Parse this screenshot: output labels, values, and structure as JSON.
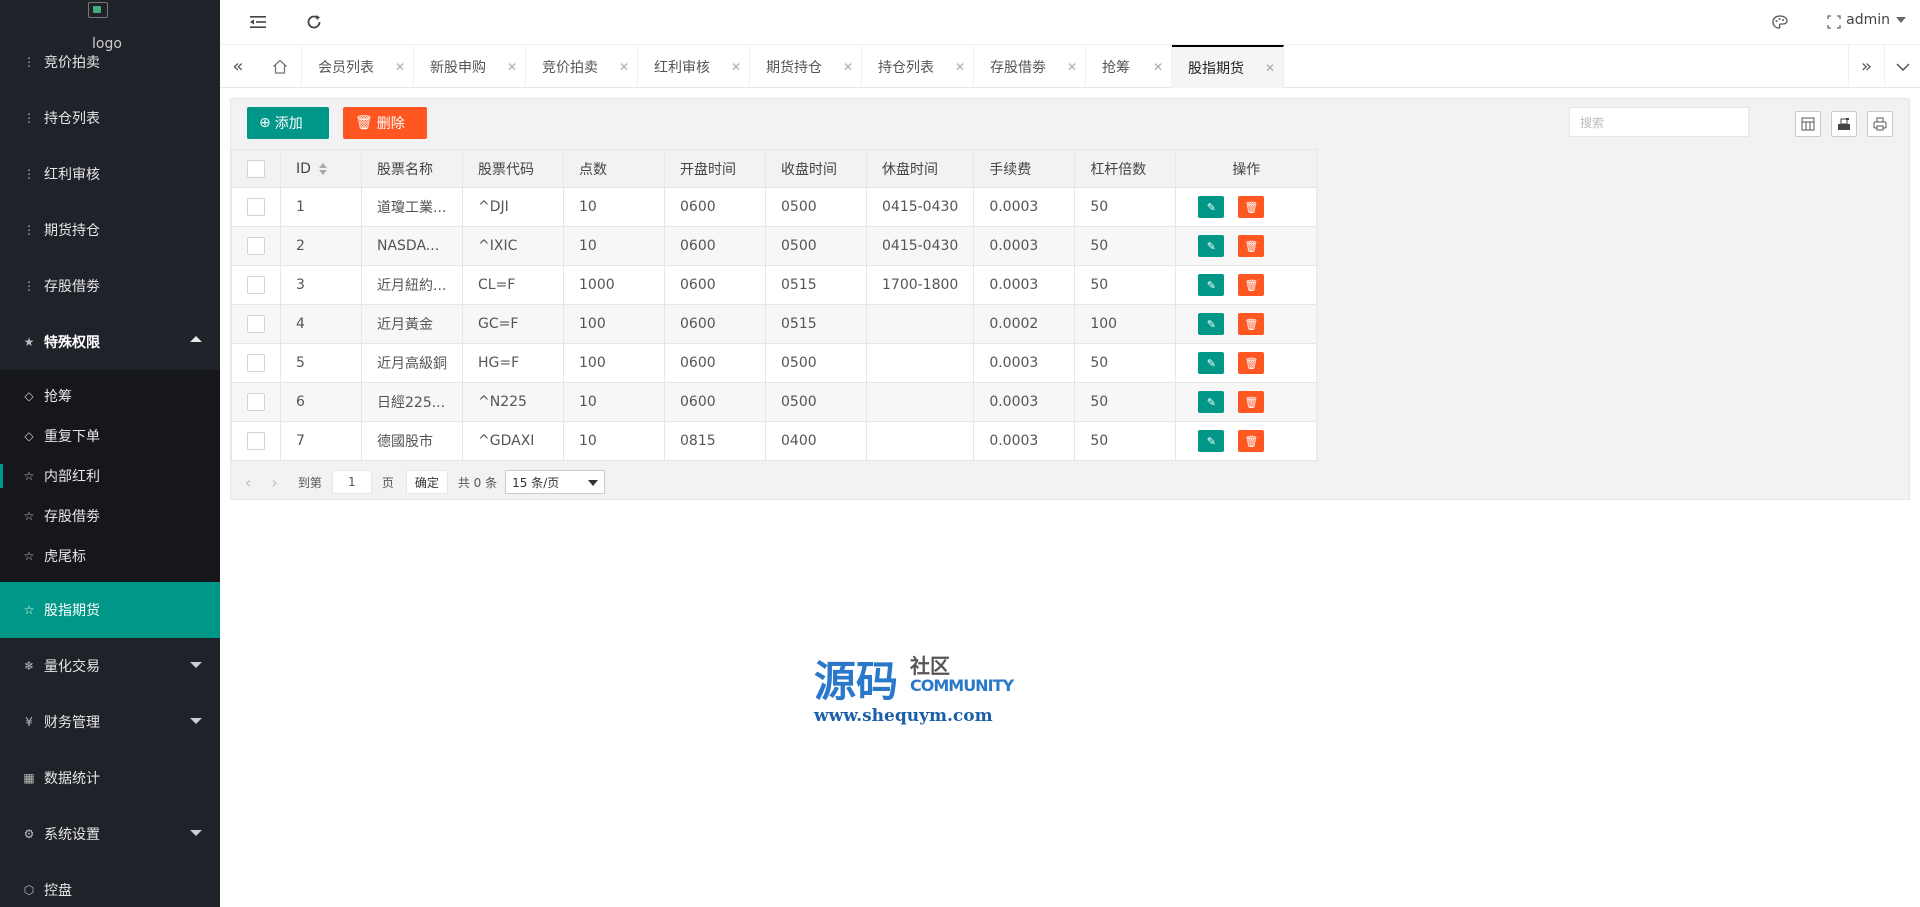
{
  "sidebar": {
    "logo_alt": "logo",
    "items": [
      {
        "label": "竞价拍卖",
        "icon": "vertical-dots-icon"
      },
      {
        "label": "持仓列表",
        "icon": "vertical-dots-icon"
      },
      {
        "label": "红利审核",
        "icon": "vertical-dots-icon"
      },
      {
        "label": "期货持仓",
        "icon": "vertical-dots-icon"
      },
      {
        "label": "存股借劵",
        "icon": "vertical-dots-icon"
      }
    ],
    "group": {
      "label": "特殊权限",
      "icon": "star-icon"
    },
    "sub_items": [
      {
        "label": "抢筹",
        "icon": "diamond-icon"
      },
      {
        "label": "重复下单",
        "icon": "diamond-icon"
      },
      {
        "label": "内部红利",
        "icon": "star-outline-icon"
      },
      {
        "label": "存股借劵",
        "icon": "star-outline-icon"
      },
      {
        "label": "虎尾标",
        "icon": "star-outline-icon"
      }
    ],
    "active_item": {
      "label": "股指期货",
      "icon": "star-outline-icon"
    },
    "bottom_items": [
      {
        "label": "量化交易",
        "icon": "snowflake-icon",
        "expandable": true
      },
      {
        "label": "财务管理",
        "icon": "yen-icon",
        "expandable": true
      },
      {
        "label": "数据统计",
        "icon": "calendar-icon",
        "expandable": false
      },
      {
        "label": "系统设置",
        "icon": "gear-icon",
        "expandable": true
      },
      {
        "label": "控盘",
        "icon": "cube-icon",
        "expandable": false
      }
    ]
  },
  "header": {
    "user": "admin"
  },
  "tabs": [
    "会员列表",
    "新股申购",
    "竞价拍卖",
    "红利审核",
    "期货持仓",
    "持仓列表",
    "存股借劵",
    "抢筹",
    "股指期货"
  ],
  "active_tab": "股指期货",
  "toolbar": {
    "add_label": "添加",
    "delete_label": "删除",
    "search_placeholder": "搜索"
  },
  "table": {
    "columns": [
      "ID",
      "股票名称",
      "股票代码",
      "点数",
      "开盘时间",
      "收盘时间",
      "休盘时间",
      "手续费",
      "杠杆倍数",
      "操作"
    ],
    "rows": [
      {
        "id": "1",
        "name": "道瓊工業...",
        "code": "^DJI",
        "points": "10",
        "open": "0600",
        "close": "0500",
        "break": "0415-0430",
        "fee": "0.0003",
        "leverage": "50"
      },
      {
        "id": "2",
        "name": "NASDA...",
        "code": "^IXIC",
        "points": "10",
        "open": "0600",
        "close": "0500",
        "break": "0415-0430",
        "fee": "0.0003",
        "leverage": "50"
      },
      {
        "id": "3",
        "name": "近月紐約...",
        "code": "CL=F",
        "points": "1000",
        "open": "0600",
        "close": "0515",
        "break": "1700-1800",
        "fee": "0.0003",
        "leverage": "50"
      },
      {
        "id": "4",
        "name": "近月黃金",
        "code": "GC=F",
        "points": "100",
        "open": "0600",
        "close": "0515",
        "break": "",
        "fee": "0.0002",
        "leverage": "100"
      },
      {
        "id": "5",
        "name": "近月高級銅",
        "code": "HG=F",
        "points": "100",
        "open": "0600",
        "close": "0500",
        "break": "",
        "fee": "0.0003",
        "leverage": "50"
      },
      {
        "id": "6",
        "name": "日經225...",
        "code": "^N225",
        "points": "10",
        "open": "0600",
        "close": "0500",
        "break": "",
        "fee": "0.0003",
        "leverage": "50"
      },
      {
        "id": "7",
        "name": "德國股市",
        "code": "^GDAXI",
        "points": "10",
        "open": "0815",
        "close": "0400",
        "break": "",
        "fee": "0.0003",
        "leverage": "50"
      }
    ]
  },
  "pager": {
    "goto_label": "到第",
    "page_value": "1",
    "page_label": "页",
    "confirm_label": "确定",
    "total_label": "共 0 条",
    "page_size": "15 条/页"
  },
  "watermark": {
    "main": "源码",
    "cn": "社区",
    "en": "COMMUNITY",
    "url": "www.shequym.com"
  }
}
